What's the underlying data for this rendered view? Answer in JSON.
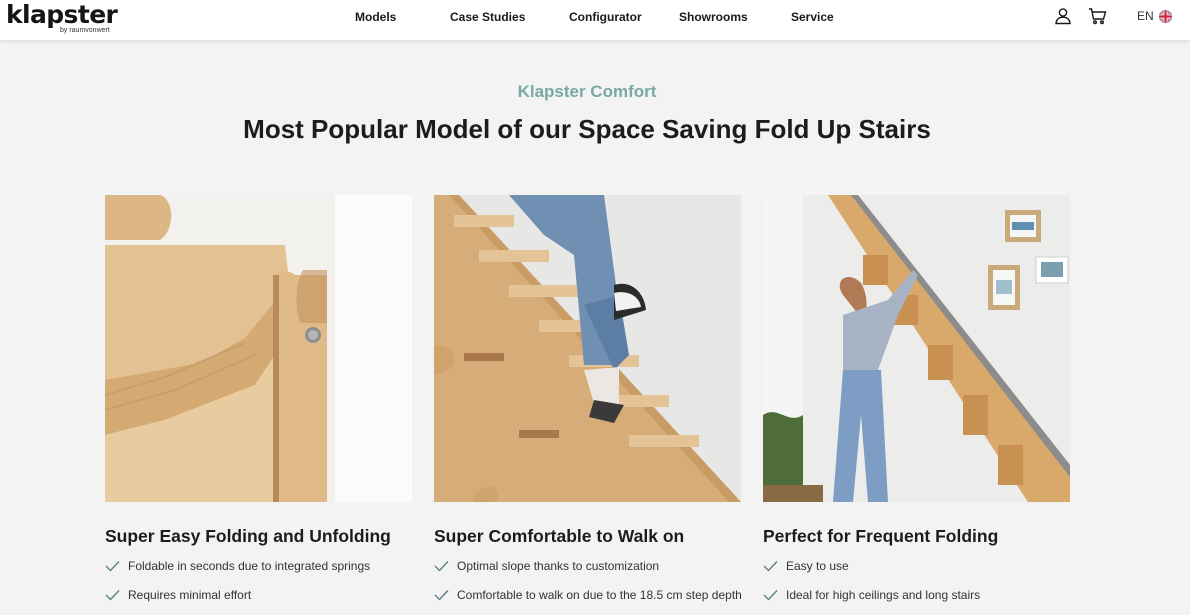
{
  "header": {
    "logo_text": "klapster",
    "logo_sub": "by raumvonwert",
    "nav": [
      "Models",
      "Case Studies",
      "Configurator",
      "Showrooms",
      "Service"
    ],
    "icons": [
      "user-icon",
      "cart-icon"
    ],
    "language": "EN",
    "flag": "uk-flag-icon"
  },
  "hero": {
    "eyebrow": "Klapster Comfort",
    "headline": "Most Popular Model of our Space Saving Fold Up Stairs"
  },
  "columns": [
    {
      "image": "closeup of plywood stair step with hinge",
      "title": "Super Easy Folding and Unfolding",
      "features": [
        "Foldable in seconds due to integrated springs",
        "Requires minimal effort"
      ]
    },
    {
      "image": "person in jeans walking up wooden stairs",
      "title": "Super Comfortable to Walk on",
      "features": [
        "Optimal slope thanks to customization",
        "Comfortable to walk on due to the 18.5 cm step depth"
      ]
    },
    {
      "image": "woman folding up stairs against wall",
      "title": "Perfect for Frequent Folding",
      "features": [
        "Easy to use",
        "Ideal for high ceilings and long stairs"
      ]
    }
  ],
  "colors": {
    "accent": "#79a8a6",
    "wood": "#d9b07a",
    "background": "#f3f3f3",
    "check": "#5a7f86"
  }
}
